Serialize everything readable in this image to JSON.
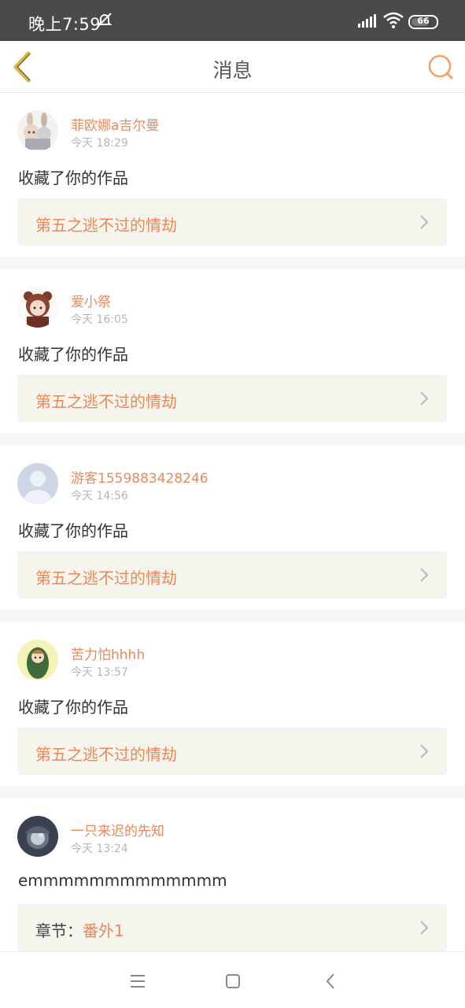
{
  "status": {
    "time": "晚上7:59",
    "battery": "66"
  },
  "header": {
    "title": "消息"
  },
  "messages": [
    {
      "user": "菲欧娜a吉尔曼",
      "time": "今天 18:29",
      "text": "收藏了你的作品",
      "work": "第五之逃不过的情劫",
      "avatar": "anime-girl-avatar"
    },
    {
      "user": "爱小祭",
      "time": "今天 16:05",
      "text": "收藏了你的作品",
      "work": "第五之逃不过的情劫",
      "avatar": "bear-hood-avatar"
    },
    {
      "user": "游客1559883428246",
      "time": "今天 14:56",
      "text": "收藏了你的作品",
      "work": "第五之逃不过的情劫",
      "avatar": "default-avatar"
    },
    {
      "user": "苦力怕hhhh",
      "time": "今天 13:57",
      "text": "收藏了你的作品",
      "work": "第五之逃不过的情劫",
      "avatar": "green-hood-avatar"
    },
    {
      "user": "一只来迟的先知",
      "time": "今天 13:24",
      "text": "emmmmmmmmmmmmm",
      "work_prefix": "章节：",
      "work": "番外1",
      "avatar": "seer-avatar"
    }
  ],
  "colors": {
    "accent": "#e8895a",
    "back_icon": "#d9b84a",
    "work_box": "#f5f5ed"
  }
}
